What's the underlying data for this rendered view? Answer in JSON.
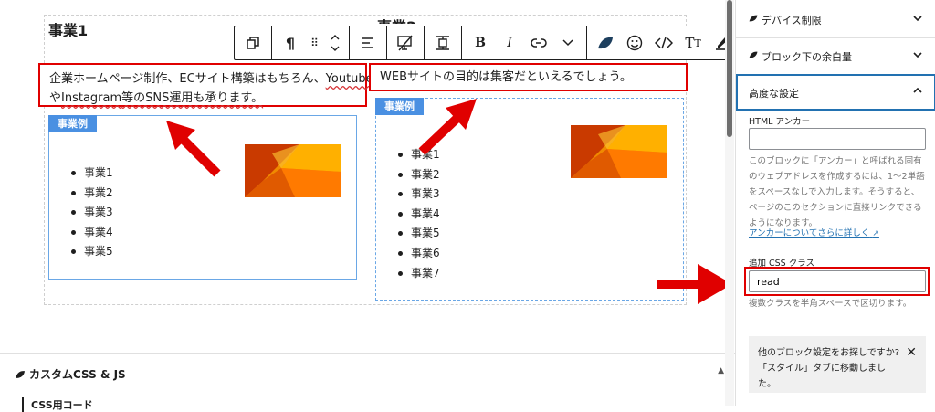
{
  "editor": {
    "col1": {
      "title": "事業1",
      "paragraph_line1_pre": "企業ホームページ制作、ECサイト構築はもちろん、",
      "paragraph_line1_link": "Youtube",
      "paragraph_line2_pre": "や",
      "paragraph_line2_link": "Instagram",
      "paragraph_line2_post": "等のSNS運用も承ります。",
      "box_label": "事業例",
      "list": [
        "事業1",
        "事業2",
        "事業3",
        "事業4",
        "事業5"
      ]
    },
    "col2": {
      "title_partial": "事業2",
      "paragraph": "WEBサイトの目的は集客だといえるでしょう。",
      "box_label": "事業例",
      "list": [
        "事業1",
        "事業2",
        "事業3",
        "事業4",
        "事業5",
        "事業6",
        "事業7"
      ]
    }
  },
  "toolbar": {
    "icons": [
      "transform-icon",
      "paragraph-icon",
      "drag-handle-icon",
      "move-updown-icon",
      "align-icon",
      "visibility-icon",
      "block-spacing-icon",
      "bold-icon",
      "italic-icon",
      "link-icon",
      "more-rich-text-icon",
      "leaf-icon",
      "emoji-icon",
      "code-icon",
      "text-size-icon",
      "highlighter-icon",
      "options-icon"
    ]
  },
  "custom_panel": {
    "title": "カスタムCSS & JS",
    "sub_label": "CSS用コード"
  },
  "sidebar": {
    "device_limit": "デバイス制限",
    "margin_below": "ブロック下の余白量",
    "advanced": "高度な設定",
    "html_anchor_label": "HTML アンカー",
    "html_anchor_value": "",
    "anchor_help": "このブロックに「アンカー」と呼ばれる固有のウェブアドレスを作成するには、1〜2単語をスペースなしで入力します。そうすると、ページのこのセクションに直接リンクできるようになります。",
    "anchor_link": "アンカーについてさらに詳しく",
    "css_class_label": "追加 CSS クラス",
    "css_class_value": "read",
    "css_class_help": "複数クラスを半角スペースで区切ります。",
    "notice": "他のブロック設定をお探しですか?「スタイル」タブに移動しました。"
  },
  "colors": {
    "highlight_red": "#e00000",
    "box_blue": "#4a90e2",
    "admin_blue": "#2271b1"
  }
}
